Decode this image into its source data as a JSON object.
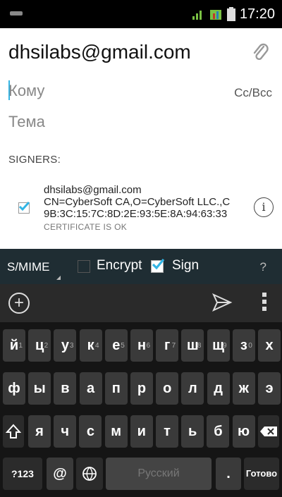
{
  "status_bar": {
    "time": "17:20",
    "icons": [
      "signal-bars-icon",
      "mobile-data-icon",
      "battery-icon"
    ]
  },
  "compose": {
    "from": "dhsilabs@gmail.com",
    "to_placeholder": "Кому",
    "cc_bcc_label": "Cc/Bcc",
    "subject_placeholder": "Тема",
    "signers_label": "SIGNERS:",
    "certificate": {
      "email": "dhsilabs@gmail.com",
      "subject": "CN=CyberSoft CA,O=CyberSoft LLC.,C",
      "fingerprint": "9B:3C:15:7C:8D:2E:93:5E:8A:94:63:33",
      "status": "CERTIFICATE IS OK",
      "checked": true
    }
  },
  "smime_bar": {
    "label": "S/MIME",
    "encrypt_label": "Encrypt",
    "encrypt_checked": false,
    "sign_label": "Sign",
    "sign_checked": true,
    "help_label": "?"
  },
  "keyboard": {
    "row1": [
      "й",
      "ц",
      "у",
      "к",
      "е",
      "н",
      "г",
      "ш",
      "щ",
      "з",
      "х"
    ],
    "row1_hints": [
      "1",
      "2",
      "3",
      "4",
      "5",
      "6",
      "7",
      "8",
      "9",
      "0",
      ""
    ],
    "row2": [
      "ф",
      "ы",
      "в",
      "а",
      "п",
      "р",
      "о",
      "л",
      "д",
      "ж",
      "э"
    ],
    "row3": [
      "я",
      "ч",
      "с",
      "м",
      "и",
      "т",
      "ь",
      "б",
      "ю"
    ],
    "symbols_label": "?123",
    "at_label": "@",
    "space_label": "Русский",
    "period_label": ".",
    "done_label": "Готово"
  }
}
